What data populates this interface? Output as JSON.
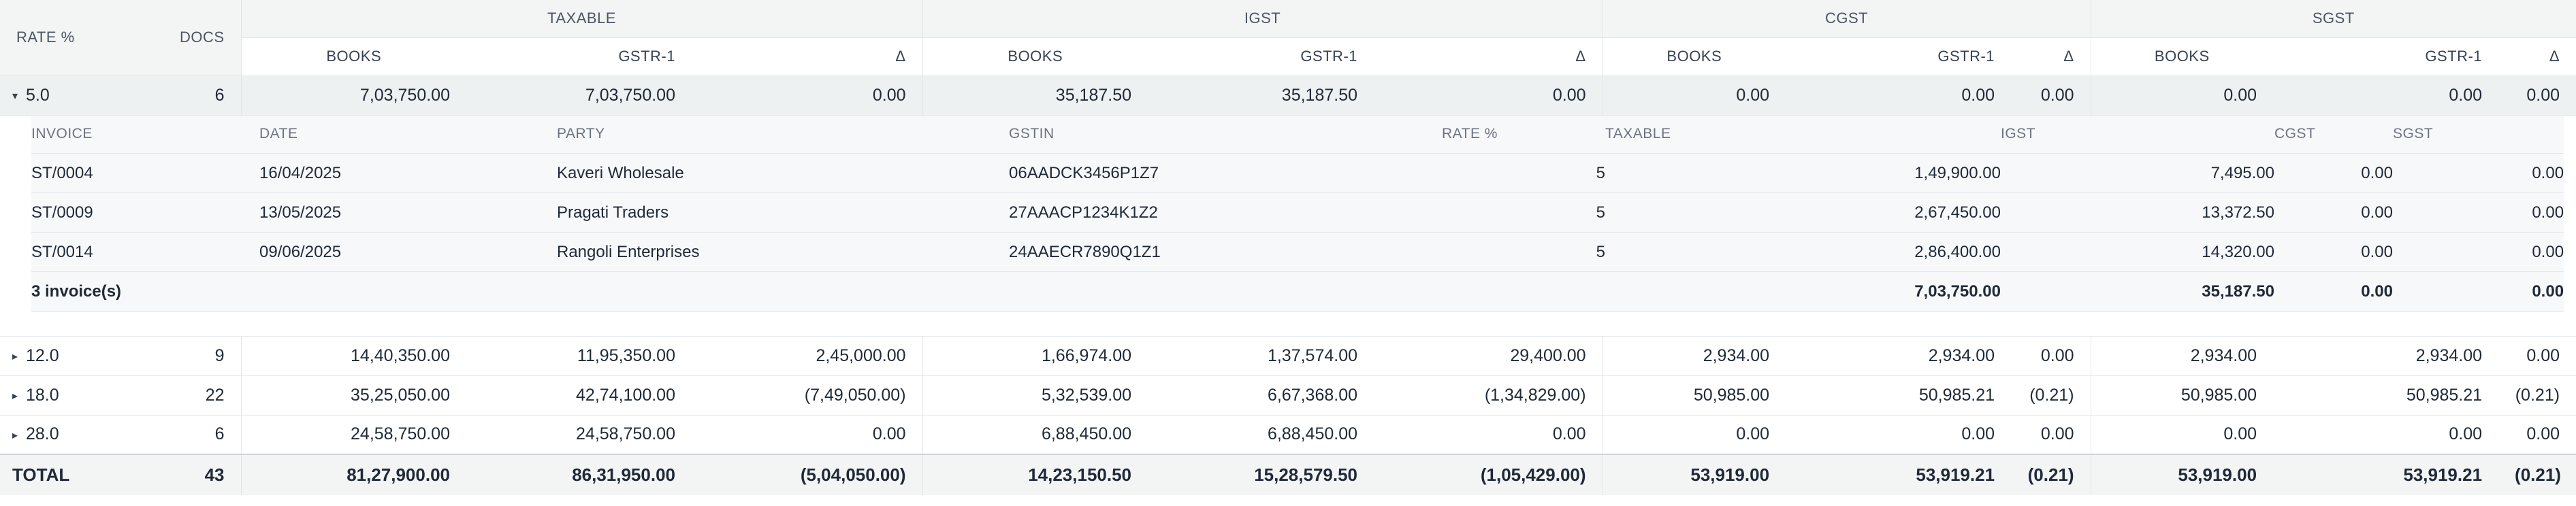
{
  "header": {
    "rate_label": "RATE %",
    "docs_label": "DOCS",
    "groups": [
      "TAXABLE",
      "IGST",
      "CGST",
      "SGST"
    ],
    "sub": {
      "books": "BOOKS",
      "gstr1": "GSTR-1",
      "delta": "Δ"
    }
  },
  "rows": [
    {
      "rate": "5.0",
      "caret": "▾",
      "docs": "6",
      "values": [
        "7,03,750.00",
        "7,03,750.00",
        "0.00",
        "35,187.50",
        "35,187.50",
        "0.00",
        "0.00",
        "0.00",
        "0.00",
        "0.00",
        "0.00",
        "0.00"
      ]
    },
    {
      "rate": "12.0",
      "caret": "▸",
      "docs": "9",
      "values": [
        "14,40,350.00",
        "11,95,350.00",
        "2,45,000.00",
        "1,66,974.00",
        "1,37,574.00",
        "29,400.00",
        "2,934.00",
        "2,934.00",
        "0.00",
        "2,934.00",
        "2,934.00",
        "0.00"
      ]
    },
    {
      "rate": "18.0",
      "caret": "▸",
      "docs": "22",
      "values": [
        "35,25,050.00",
        "42,74,100.00",
        "(7,49,050.00)",
        "5,32,539.00",
        "6,67,368.00",
        "(1,34,829.00)",
        "50,985.00",
        "50,985.21",
        "(0.21)",
        "50,985.00",
        "50,985.21",
        "(0.21)"
      ]
    },
    {
      "rate": "28.0",
      "caret": "▸",
      "docs": "6",
      "values": [
        "24,58,750.00",
        "24,58,750.00",
        "0.00",
        "6,88,450.00",
        "6,88,450.00",
        "0.00",
        "0.00",
        "0.00",
        "0.00",
        "0.00",
        "0.00",
        "0.00"
      ]
    }
  ],
  "detail": {
    "headers": {
      "invoice": "INVOICE",
      "date": "DATE",
      "party": "PARTY",
      "gstin": "GSTIN",
      "rate": "RATE %",
      "taxable": "TAXABLE",
      "igst": "IGST",
      "cgst": "CGST",
      "sgst": "SGST"
    },
    "invoices": [
      {
        "invoice": "ST/0004",
        "date": "16/04/2025",
        "party": "Kaveri Wholesale",
        "gstin": "06AADCK3456P1Z7",
        "rate": "5",
        "taxable": "1,49,900.00",
        "igst": "7,495.00",
        "cgst": "0.00",
        "sgst": "0.00"
      },
      {
        "invoice": "ST/0009",
        "date": "13/05/2025",
        "party": "Pragati Traders",
        "gstin": "27AAACP1234K1Z2",
        "rate": "5",
        "taxable": "2,67,450.00",
        "igst": "13,372.50",
        "cgst": "0.00",
        "sgst": "0.00"
      },
      {
        "invoice": "ST/0014",
        "date": "09/06/2025",
        "party": "Rangoli Enterprises",
        "gstin": "24AAECR7890Q1Z1",
        "rate": "5",
        "taxable": "2,86,400.00",
        "igst": "14,320.00",
        "cgst": "0.00",
        "sgst": "0.00"
      }
    ],
    "footer": {
      "count": "3 invoice(s)",
      "taxable": "7,03,750.00",
      "igst": "35,187.50",
      "cgst": "0.00",
      "sgst": "0.00"
    }
  },
  "total": {
    "label": "TOTAL",
    "docs": "43",
    "values": [
      "81,27,900.00",
      "86,31,950.00",
      "(5,04,050.00)",
      "14,23,150.50",
      "15,28,579.50",
      "(1,05,429.00)",
      "53,919.00",
      "53,919.21",
      "(0.21)",
      "53,919.00",
      "53,919.21",
      "(0.21)"
    ]
  }
}
